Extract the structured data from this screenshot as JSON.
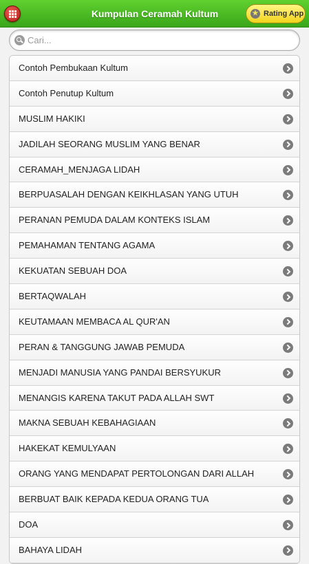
{
  "header": {
    "title": "Kumpulan Ceramah Kultum",
    "menu_icon": "grid-icon",
    "rating_button": {
      "label": "Rating App",
      "icon": "star-icon"
    },
    "colors": {
      "bar": "#4cbf23",
      "menu": "#c62a22",
      "rating": "#f7e33a"
    }
  },
  "search": {
    "placeholder": "Cari...",
    "value": ""
  },
  "list": {
    "items": [
      {
        "label": "Contoh Pembukaan Kultum"
      },
      {
        "label": "Contoh Penutup Kultum"
      },
      {
        "label": "MUSLIM HAKIKI"
      },
      {
        "label": "JADILAH SEORANG MUSLIM YANG BENAR"
      },
      {
        "label": "CERAMAH_MENJAGA LIDAH"
      },
      {
        "label": "BERPUASALAH DENGAN KEIKHLASAN YANG UTUH"
      },
      {
        "label": "PERANAN PEMUDA DALAM KONTEKS ISLAM"
      },
      {
        "label": "PEMAHAMAN TENTANG AGAMA"
      },
      {
        "label": "KEKUATAN SEBUAH DOA"
      },
      {
        "label": "BERTAQWALAH"
      },
      {
        "label": "KEUTAMAAN MEMBACA AL QUR'AN"
      },
      {
        "label": "PERAN & TANGGUNG JAWAB PEMUDA"
      },
      {
        "label": "MENJADI MANUSIA YANG PANDAI BERSYUKUR"
      },
      {
        "label": "MENANGIS KARENA TAKUT PADA ALLAH SWT"
      },
      {
        "label": "MAKNA SEBUAH KEBAHAGIAAN"
      },
      {
        "label": "HAKEKAT KEMULYAAN"
      },
      {
        "label": "ORANG YANG MENDAPAT PERTOLONGAN DARI ALLAH"
      },
      {
        "label": "BERBUAT BAIK KEPADA KEDUA ORANG TUA"
      },
      {
        "label": "DOA"
      },
      {
        "label": "BAHAYA LIDAH"
      }
    ]
  }
}
